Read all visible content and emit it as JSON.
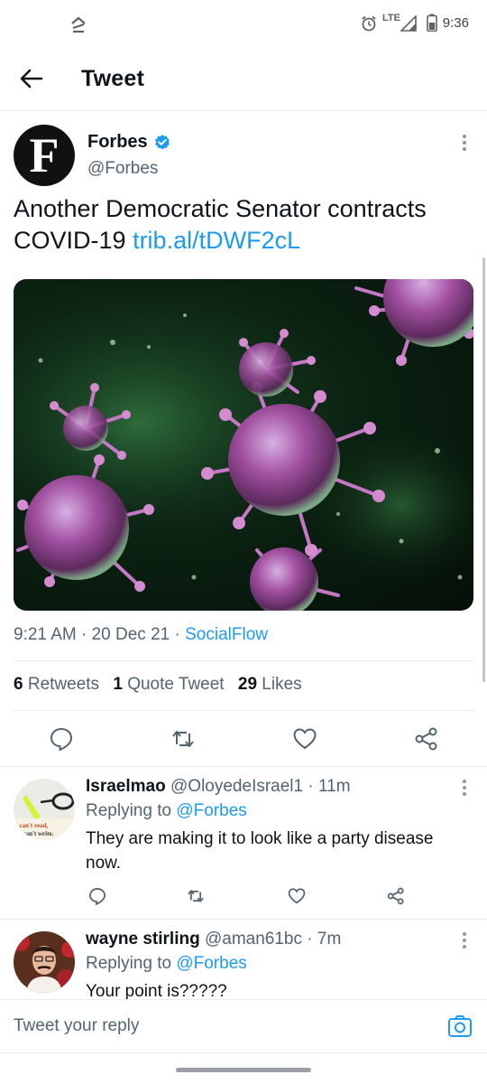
{
  "status_bar": {
    "time": "9:36",
    "network": "LTE",
    "icons": [
      "app-notification-icon",
      "alarm-icon",
      "signal-icon",
      "battery-icon"
    ]
  },
  "header": {
    "title": "Tweet",
    "back_icon": "back-arrow-icon"
  },
  "tweet": {
    "author_name": "Forbes",
    "handle": "@Forbes",
    "avatar_letter": "F",
    "verified": true,
    "text": "Another Democratic Senator contracts COVID-19",
    "link": "trib.al/tDWF2cL",
    "timestamp": "9:21 AM",
    "date": "20 Dec 21",
    "source": "SocialFlow",
    "stats": {
      "retweets_count": "6",
      "retweets_label": "Retweets",
      "quotes_count": "1",
      "quotes_label": "Quote Tweet",
      "likes_count": "29",
      "likes_label": "Likes"
    }
  },
  "replies": [
    {
      "name": "Israelmao",
      "handle": "@OloyedeIsrael1",
      "time": "11m",
      "replying_prefix": "Replying to",
      "replying_to": "@Forbes",
      "text": "They are making it to look like a party disease now.",
      "avatar_caption_1": "I can't read,",
      "avatar_caption_2": "I can't write."
    },
    {
      "name": "wayne stirling",
      "handle": "@aman61bc",
      "time": "7m",
      "replying_prefix": "Replying to",
      "replying_to": "@Forbes",
      "text": "Your point is?????"
    }
  ],
  "composer": {
    "placeholder": "Tweet your reply",
    "camera_icon": "camera-icon"
  },
  "colors": {
    "accent": "#1d9bf0",
    "text": "#0f1419",
    "muted": "#536471",
    "divider": "#e6ecf0"
  }
}
